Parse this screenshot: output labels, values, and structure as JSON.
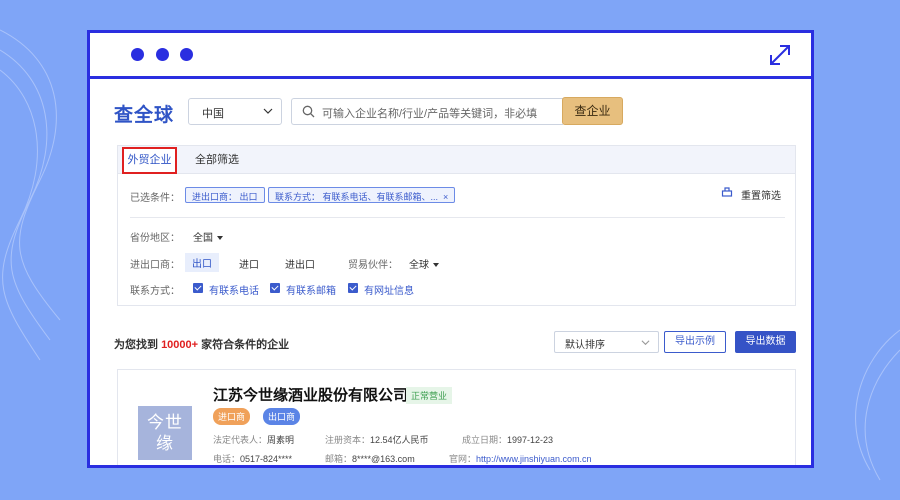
{
  "colors": {
    "background": "#7fa5f7",
    "frame": "#2a2ee0",
    "accent": "#2f54c6",
    "search_button": "#e7bf7e",
    "highlight_red": "#e02020"
  },
  "window": {
    "icons": [
      "dot-icon",
      "dot-icon",
      "dot-icon",
      "expand-icon"
    ]
  },
  "header": {
    "brand": "查全球",
    "region_value": "中国",
    "search_placeholder": "可输入企业名称/行业/产品等关键词，非必填",
    "search_button": "查企业"
  },
  "tabs": [
    {
      "label": "外贸企业",
      "active": true
    },
    {
      "label": "全部筛选",
      "active": false
    }
  ],
  "filters": {
    "selected_label": "已选条件：",
    "chips": [
      "进出口商： 出口",
      "联系方式： 有联系电话、有联系邮箱、..."
    ],
    "reset_label": "重置筛选",
    "province_label": "省份地区：",
    "province_value": "全国",
    "trade_label": "进出口商：",
    "trade_options": [
      "出口",
      "进口",
      "进出口"
    ],
    "trade_selected": "出口",
    "partner_label": "贸易伙伴：",
    "partner_value": "全球",
    "contact_label": "联系方式：",
    "contact_options": [
      "有联系电话",
      "有联系邮箱",
      "有网址信息"
    ]
  },
  "results": {
    "prefix": "为您找到",
    "count": "10000+",
    "suffix": "家符合条件的企业",
    "sort_value": "默认排序",
    "export_sample": "导出示例",
    "export_data": "导出数据"
  },
  "company": {
    "logo_text": "今世\n缘",
    "name": "江苏今世缘酒业股份有限公司",
    "status": "正常营业",
    "tags": [
      "进口商",
      "出口商"
    ],
    "legal_rep_label": "法定代表人：",
    "legal_rep": "周素明",
    "capital_label": "注册资本：",
    "capital": "12.54亿人民币",
    "founded_label": "成立日期：",
    "founded": "1997-12-23",
    "phone_label": "电话：",
    "phone": "0517-824****",
    "email_label": "邮箱：",
    "email": "8****@163.com",
    "website_label": "官网：",
    "website": "http://www.jinshiyuan.com.cn"
  }
}
